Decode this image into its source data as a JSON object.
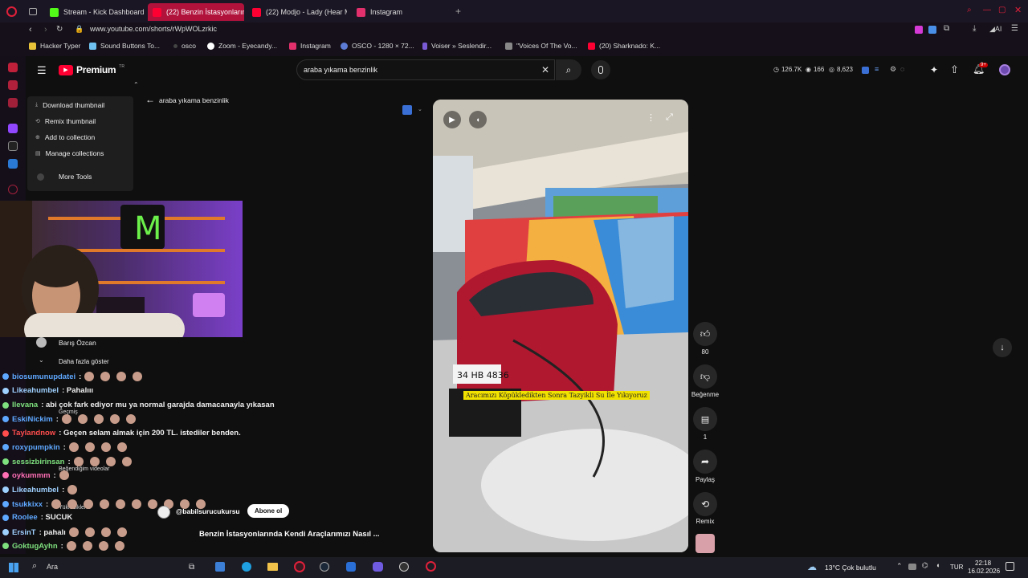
{
  "browser": {
    "tabs": [
      {
        "label": "Stream - Kick Dashboard",
        "color": "#53fc18"
      },
      {
        "label": "(22) Benzin İstasyonlarında",
        "color": "#ff0033"
      },
      {
        "label": "(22) Modjo - Lady (Hear M",
        "color": "#ff0033"
      },
      {
        "label": "Instagram",
        "color": "#e1306c"
      }
    ],
    "url": "www.youtube.com/shorts/rWpWOLzrkic",
    "bookmarks": [
      "Hacker Typer",
      "Sound Buttons To...",
      "osco",
      "Zoom - Eyecandy...",
      "Instagram",
      "OSCO - 1280 × 72...",
      "Voiser » Seslendir...",
      "\"Voices Of The Vo...",
      "(20) Sharknado: K..."
    ]
  },
  "youtube": {
    "logo_text": "Premium",
    "logo_sup": "TR",
    "search_value": "araba yıkama benzinlik",
    "back_label": "araba yıkama benzinlik",
    "stats": [
      "126.7K",
      "166",
      "8,623"
    ],
    "notif_badge": "9+"
  },
  "context_menu": {
    "items": [
      "Download thumbnail",
      "Remix thumbnail",
      "Add to collection",
      "Manage collections"
    ],
    "more_tools": "More Tools"
  },
  "sidebar_overlay": {
    "user": "Barış Özcan",
    "show_more": "Daha fazla göster",
    "history": "Geçmiş",
    "liked": "Beğendiğim videolar",
    "playlists": "Yüklediklerin"
  },
  "chat": [
    {
      "user": "biosumunupdatei",
      "color": "#5fa8ff",
      "msg": ": ",
      "emotes": 4
    },
    {
      "user": "Likeahumbel",
      "color": "#9fd1ff",
      "msg": ": Pahalııı",
      "emotes": 0
    },
    {
      "user": "Ilevana",
      "color": "#7ee07e",
      "msg": ": abi çok fark ediyor mu ya normal garajda damacanayla yıkasan",
      "emotes": 0
    },
    {
      "user": "EskiNickim",
      "color": "#5fa8ff",
      "msg": ": ",
      "emotes": 5
    },
    {
      "user": "Taylandnow",
      "color": "#ff4d4d",
      "msg": ": Geçen selam almak için 200 TL. istediler benden.",
      "emotes": 0
    },
    {
      "user": "roxypumpkin",
      "color": "#5fa8ff",
      "msg": ": ",
      "emotes": 4
    },
    {
      "user": "sessizbirinsan",
      "color": "#7ee07e",
      "msg": ": ",
      "emotes": 4
    },
    {
      "user": "oykummm",
      "color": "#ff6fb5",
      "msg": ": ",
      "emotes": 1
    },
    {
      "user": "Likeahumbel",
      "color": "#9fd1ff",
      "msg": ": ",
      "emotes": 1
    },
    {
      "user": "tsukkixx",
      "color": "#5fa8ff",
      "msg": ": ",
      "emotes": 10
    },
    {
      "user": "Roolee",
      "color": "#5fa8ff",
      "msg": ": SUCUK",
      "emotes": 0
    },
    {
      "user": "ErsinT",
      "color": "#9fd1ff",
      "msg": ": pahalı",
      "emotes": 4
    },
    {
      "user": "GoktugAyhn",
      "color": "#7ee07e",
      "msg": ": ",
      "emotes": 4
    }
  ],
  "video": {
    "caption": "Aracımızı Köpükledikten Sonra Tazyikli Su İle Yıkıyoruz",
    "plate": "34 HB 4836",
    "channel": "@babilsurucukursu",
    "subscribe": "Abone ol",
    "title": "Benzin İstasyonlarında Kendi Araçlarımızı Nasıl ...",
    "likes": "80",
    "dislike_label": "Beğenme",
    "comments": "1",
    "share_label": "Paylaş",
    "remix_label": "Remix"
  },
  "taskbar": {
    "search": "Ara",
    "weather": "13°C  Çok bulutlu",
    "lang": "TUR",
    "time": "22:18",
    "date": "16.02.2026"
  },
  "colors": {
    "accent": "#ff0033",
    "tab_active": "#b0123c"
  }
}
